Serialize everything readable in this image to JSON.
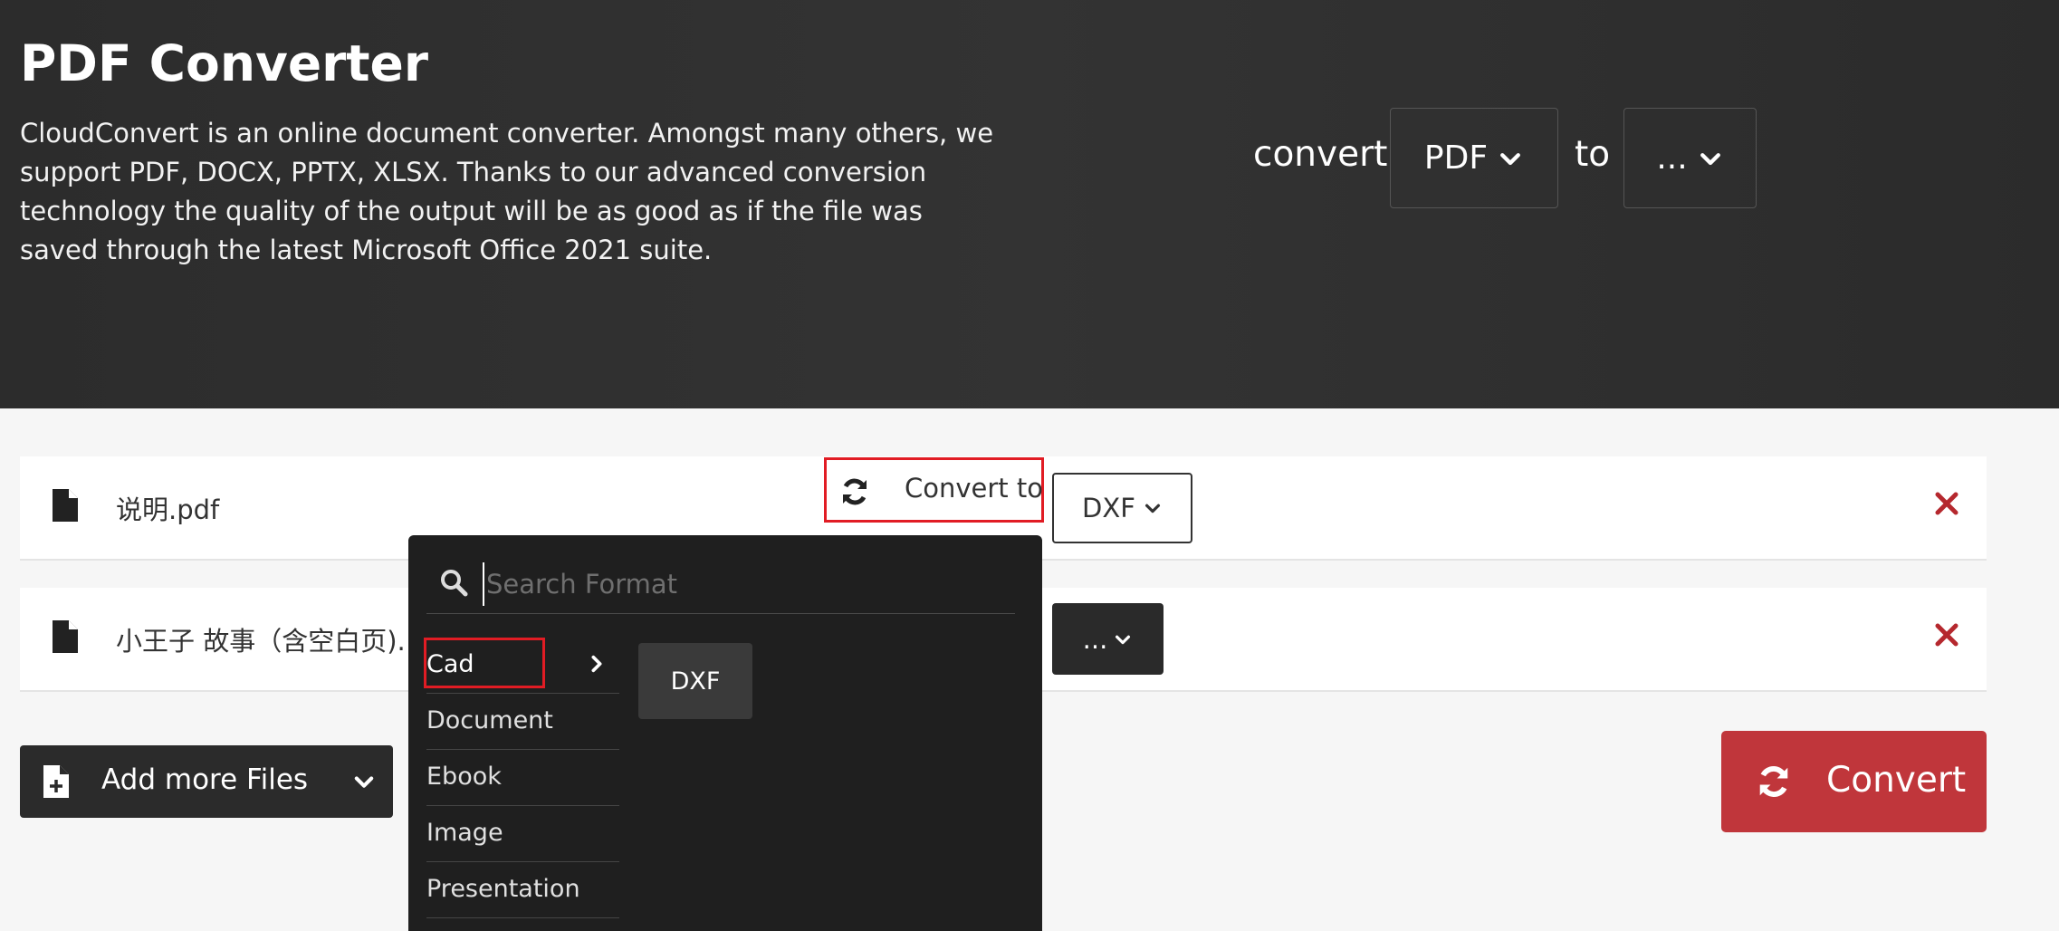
{
  "hero": {
    "title": "PDF Converter",
    "description": "CloudConvert is an online document converter. Amongst many others, we support PDF, DOCX, PPTX, XLSX. Thanks to our advanced conversion technology the quality of the output will be as good as if the file was saved through the latest Microsoft Office 2021 suite.",
    "convert_word": "convert",
    "from_format": "PDF",
    "to_word": "to",
    "to_format": "..."
  },
  "files": [
    {
      "name": "说明.pdf",
      "convert_to_label": "Convert to",
      "target_format": "DXF"
    },
    {
      "name": "小王子 故事（含空白页).",
      "target_format": "..."
    }
  ],
  "dropdown": {
    "search_placeholder": "Search Format",
    "categories": [
      "Cad",
      "Document",
      "Ebook",
      "Image",
      "Presentation"
    ],
    "active_category": "Cad",
    "formats": [
      "DXF"
    ]
  },
  "actions": {
    "add_files_label": "Add more Files",
    "convert_label": "Convert"
  },
  "colors": {
    "hero_background": "#2f2f2f",
    "convert_button": "#c0363b",
    "remove_icon": "#b5282e",
    "highlight_box": "#e11c24"
  },
  "icons": {
    "file": "file-icon",
    "remove": "close-icon",
    "refresh": "refresh-icon",
    "search": "search-icon",
    "chevron": "chevron-down-icon",
    "arrow": "chevron-right-icon",
    "add_file": "file-plus-icon"
  }
}
